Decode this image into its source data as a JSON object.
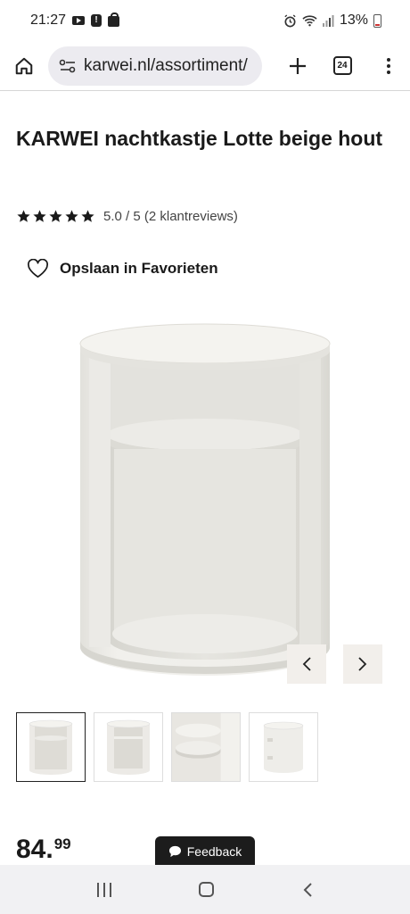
{
  "status": {
    "time": "21:27",
    "battery": "13%"
  },
  "browser": {
    "url": "karwei.nl/assortiment/",
    "tab_count": "24"
  },
  "product": {
    "title": "KARWEI nachtkastje Lotte beige hout",
    "rating_text": "5.0 / 5 (2 klantreviews)",
    "star_count": 5,
    "favorite_label": "Opslaan in Favorieten",
    "price_int": "84.",
    "price_dec": "99"
  },
  "feedback": {
    "label": "Feedback"
  },
  "colors": {
    "accent": "#1a1a1a",
    "nav_btn_bg": "#f2efeb",
    "url_bg": "#ecebf0"
  }
}
